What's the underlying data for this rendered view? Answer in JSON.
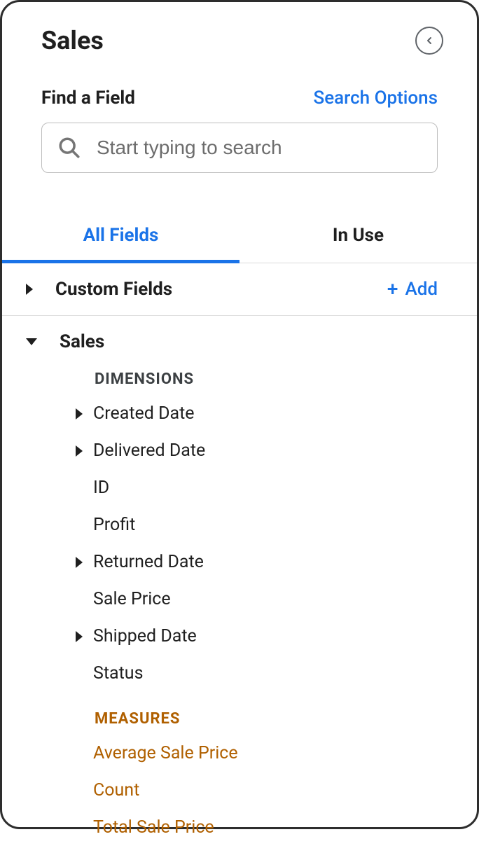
{
  "header": {
    "title": "Sales"
  },
  "search": {
    "find_label": "Find a Field",
    "options_label": "Search Options",
    "placeholder": "Start typing to search"
  },
  "tabs": {
    "all_fields": "All Fields",
    "in_use": "In Use"
  },
  "custom_fields": {
    "label": "Custom Fields",
    "add_label": "Add"
  },
  "sales": {
    "label": "Sales",
    "dimensions_heading": "DIMENSIONS",
    "measures_heading": "MEASURES",
    "dimensions": {
      "created_date": "Created Date",
      "delivered_date": "Delivered Date",
      "id": "ID",
      "profit": "Profit",
      "returned_date": "Returned Date",
      "sale_price": "Sale Price",
      "shipped_date": "Shipped Date",
      "status": "Status"
    },
    "measures": {
      "average_sale_price": "Average Sale Price",
      "count": "Count",
      "total_sale_price": "Total Sale Price"
    }
  }
}
